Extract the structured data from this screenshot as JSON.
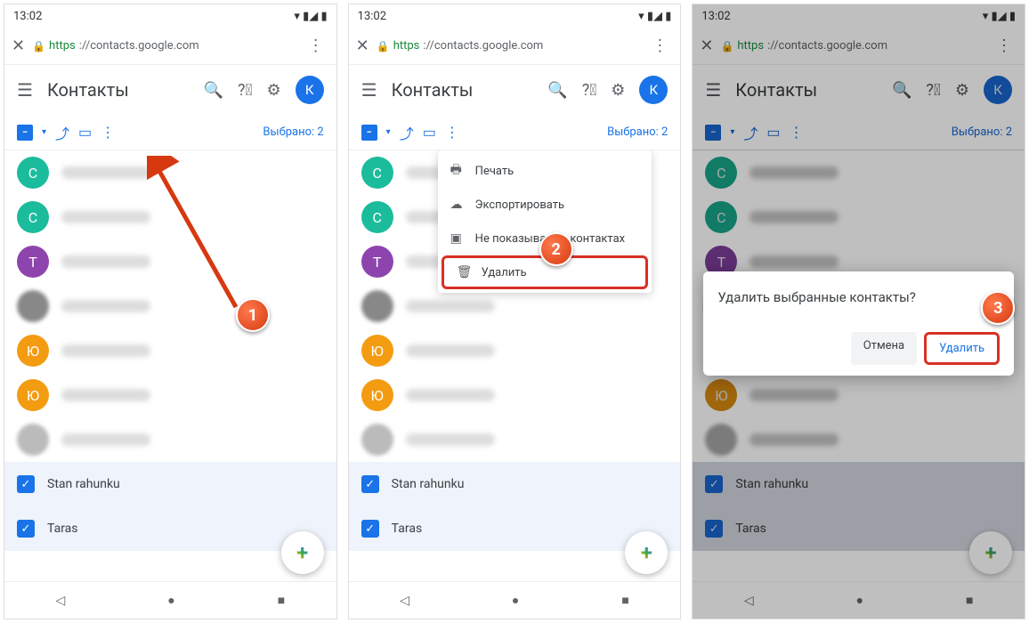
{
  "status": {
    "time": "13:02"
  },
  "browser": {
    "https": "https",
    "url": "://contacts.google.com"
  },
  "header": {
    "title": "Контакты",
    "avatar_letter": "К"
  },
  "toolbar": {
    "selected": "Выбрано: 2"
  },
  "contacts": [
    {
      "letter": "C",
      "color": "#1abc9c"
    },
    {
      "letter": "C",
      "color": "#1abc9c"
    },
    {
      "letter": "T",
      "color": "#8e44ad"
    },
    {
      "letter": "",
      "color": "#888"
    },
    {
      "letter": "Ю",
      "color": "#f39c12"
    },
    {
      "letter": "Ю",
      "color": "#f39c12"
    },
    {
      "letter": "",
      "color": "#bbb"
    }
  ],
  "selected_contacts": [
    {
      "name": "Stan rahunku"
    },
    {
      "name": "Taras"
    }
  ],
  "menu": {
    "print": "Печать",
    "export": "Экспортировать",
    "hide": "Не показывать в контактах",
    "delete": "Удалить"
  },
  "dialog": {
    "title": "Удалить выбранные контакты?",
    "cancel": "Отмена",
    "confirm": "Удалить"
  },
  "callouts": {
    "n1": "1",
    "n2": "2",
    "n3": "3"
  }
}
